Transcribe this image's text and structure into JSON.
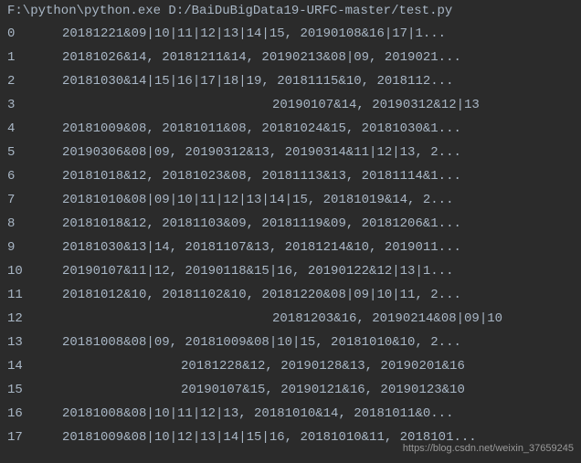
{
  "command": "F:\\python\\python.exe D:/BaiDuBigData19-URFC-master/test.py",
  "rows": [
    {
      "index": "0",
      "value": "20181221&09|10|11|12|13|14|15, 20190108&16|17|1..."
    },
    {
      "index": "1",
      "value": "20181026&14, 20181211&14, 20190213&08|09, 2019021..."
    },
    {
      "index": "2",
      "value": "20181030&14|15|16|17|18|19, 20181115&10, 2018112..."
    },
    {
      "index": "3",
      "value": "20190107&14, 20190312&12|13",
      "align": "right"
    },
    {
      "index": "4",
      "value": "20181009&08, 20181011&08, 20181024&15, 20181030&1..."
    },
    {
      "index": "5",
      "value": "20190306&08|09, 20190312&13, 20190314&11|12|13, 2..."
    },
    {
      "index": "6",
      "value": "20181018&12, 20181023&08, 20181113&13, 20181114&1..."
    },
    {
      "index": "7",
      "value": "20181010&08|09|10|11|12|13|14|15, 20181019&14, 2..."
    },
    {
      "index": "8",
      "value": "20181018&12, 20181103&09, 20181119&09, 20181206&1..."
    },
    {
      "index": "9",
      "value": "20181030&13|14, 20181107&13, 20181214&10, 2019011..."
    },
    {
      "index": "10",
      "value": "20190107&11|12, 20190118&15|16, 20190122&12|13|1..."
    },
    {
      "index": "11",
      "value": "20181012&10, 20181102&10, 20181220&08|09|10|11, 2..."
    },
    {
      "index": "12",
      "value": "20181203&16, 20190214&08|09|10",
      "align": "right"
    },
    {
      "index": "13",
      "value": "20181008&08|09, 20181009&08|10|15, 20181010&10, 2..."
    },
    {
      "index": "14",
      "value": "20181228&12, 20190128&13, 20190201&16",
      "align": "right-mid"
    },
    {
      "index": "15",
      "value": "20190107&15, 20190121&16, 20190123&10",
      "align": "right-mid"
    },
    {
      "index": "16",
      "value": "20181008&08|10|11|12|13, 20181010&14, 20181011&0..."
    },
    {
      "index": "17",
      "value": "20181009&08|10|12|13|14|15|16, 20181010&11, 2018101..."
    }
  ],
  "watermark": "https://blog.csdn.net/weixin_37659245"
}
